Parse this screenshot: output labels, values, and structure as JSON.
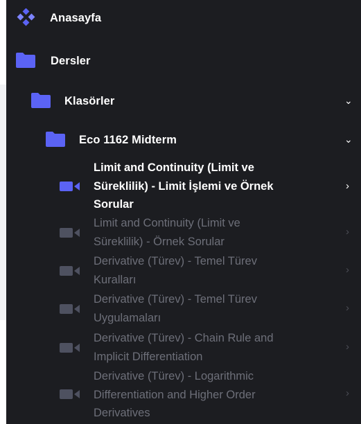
{
  "colors": {
    "sidebar_bg": "#1c1d21",
    "accent": "#5b63f5",
    "text_primary": "#ffffff",
    "text_muted": "#6d6f79",
    "icon_muted": "#4e5160"
  },
  "nav": {
    "home_label": "Anasayfa",
    "courses_label": "Dersler",
    "folders_label": "Klasörler",
    "course_label": "Eco 1162 Midterm"
  },
  "lessons": [
    {
      "line1": "Limit and Continuity (Limit ve",
      "line2": "Süreklilik) - Limit İşlemi ve Örnek",
      "line3": "Sorular",
      "active": true
    },
    {
      "line1": "Limit and Continuity (Limit ve",
      "line2": "Süreklilik) - Örnek Sorular",
      "line3": "",
      "active": false
    },
    {
      "line1": "Derivative (Türev) - Temel Türev",
      "line2": "Kuralları",
      "line3": "",
      "active": false
    },
    {
      "line1": "Derivative (Türev) - Temel Türev",
      "line2": "Uygulamaları",
      "line3": "",
      "active": false
    },
    {
      "line1": "Derivative (Türev) - Chain Rule and",
      "line2": "Implicit Differentiation",
      "line3": "",
      "active": false
    },
    {
      "line1": "Derivative (Türev) - Logarithmic",
      "line2": "Differentiation and Higher Order",
      "line3": "Derivatives",
      "active": false
    }
  ]
}
